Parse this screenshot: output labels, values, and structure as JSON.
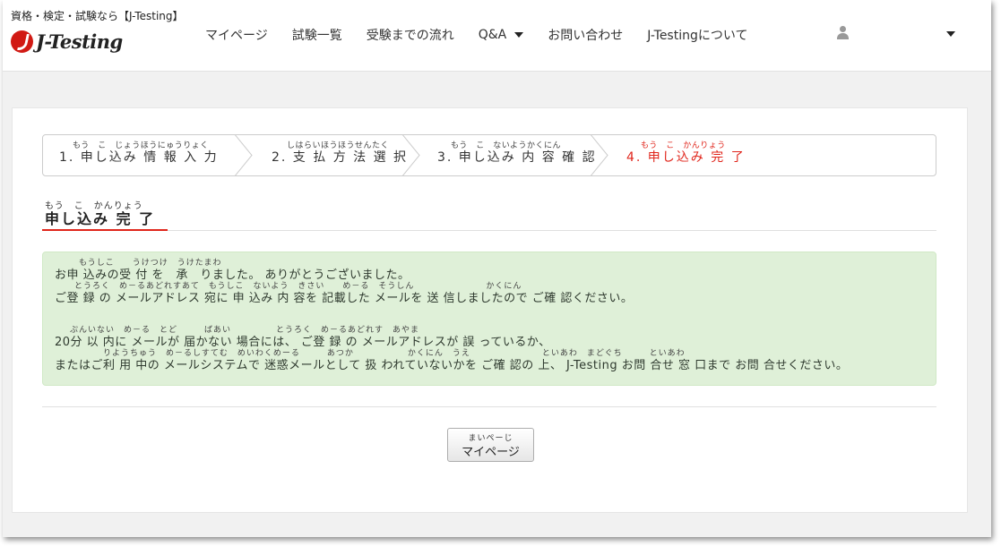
{
  "header": {
    "tagline": "資格・検定・試験なら【J-Testing】",
    "logo_text": "J-Testing",
    "nav": [
      {
        "label": "マイページ"
      },
      {
        "label": "試験一覧"
      },
      {
        "label": "受験までの流れ"
      },
      {
        "label": "Q&A",
        "dropdown": true
      },
      {
        "label": "お問い合わせ"
      },
      {
        "label": "J-Testingについて"
      }
    ],
    "user_icon": "user-icon"
  },
  "steps": [
    {
      "ruby": "もう　こ　じょうほうにゅうりょく",
      "label": "1. 申し込み 情 報 入 力",
      "active": false
    },
    {
      "ruby": "しはらいほうほうせんたく",
      "label": "2. 支 払 方 法 選 択",
      "active": false
    },
    {
      "ruby": "もう　こ　ないようかくにん",
      "label": "3. 申し込み 内 容 確 認",
      "active": false
    },
    {
      "ruby": "もう　こ　かんりょう",
      "label": "4. 申し込み 完 了",
      "active": true
    }
  ],
  "section": {
    "ruby": "もう　こ　かんりょう",
    "title": "申し込み 完 了"
  },
  "message": {
    "line1_ruby": "もうしこ　　うけつけ　うけたまわ",
    "line1": "お申 込みの受 付 を　承　りました。 ありがとうございました。",
    "line2_ruby": "とうろく　め－るあどれすあて　もうしこ　ないよう　きさい　　め－る　そうしん　　　　　　　　かくにん",
    "line2": "ご登 録 の メールアドレス 宛に 申 込み 内 容を 記載した メールを 送 信しましたので ご確 認ください。",
    "line3_ruby": "ぷんいない　め－る　とど　　　ばあい　　　　　とうろく　め－るあどれす　あやま",
    "line3": "20分 以 内に メールが 届かない 場合には、 ご登 録 の メールアドレスが 誤 っているか、",
    "line4_ruby": "りようちゅう　め－るしすてむ　めいわくめーる　　　あつか　　　　　　かくにん　うえ　　　　　　　　といあわ　まどぐち　　　といあわ",
    "line4": "またはご利 用 中の メールシステムで 迷惑メールとして 扱 われていないかを ご確 認の 上、 J-Testing お問 合せ 窓 口まで お問 合せください。"
  },
  "mypage_button": {
    "ruby": "まいぺーじ",
    "label": "マイページ"
  },
  "colors": {
    "accent_red": "#e0251b",
    "success_bg": "#dff0d8"
  }
}
